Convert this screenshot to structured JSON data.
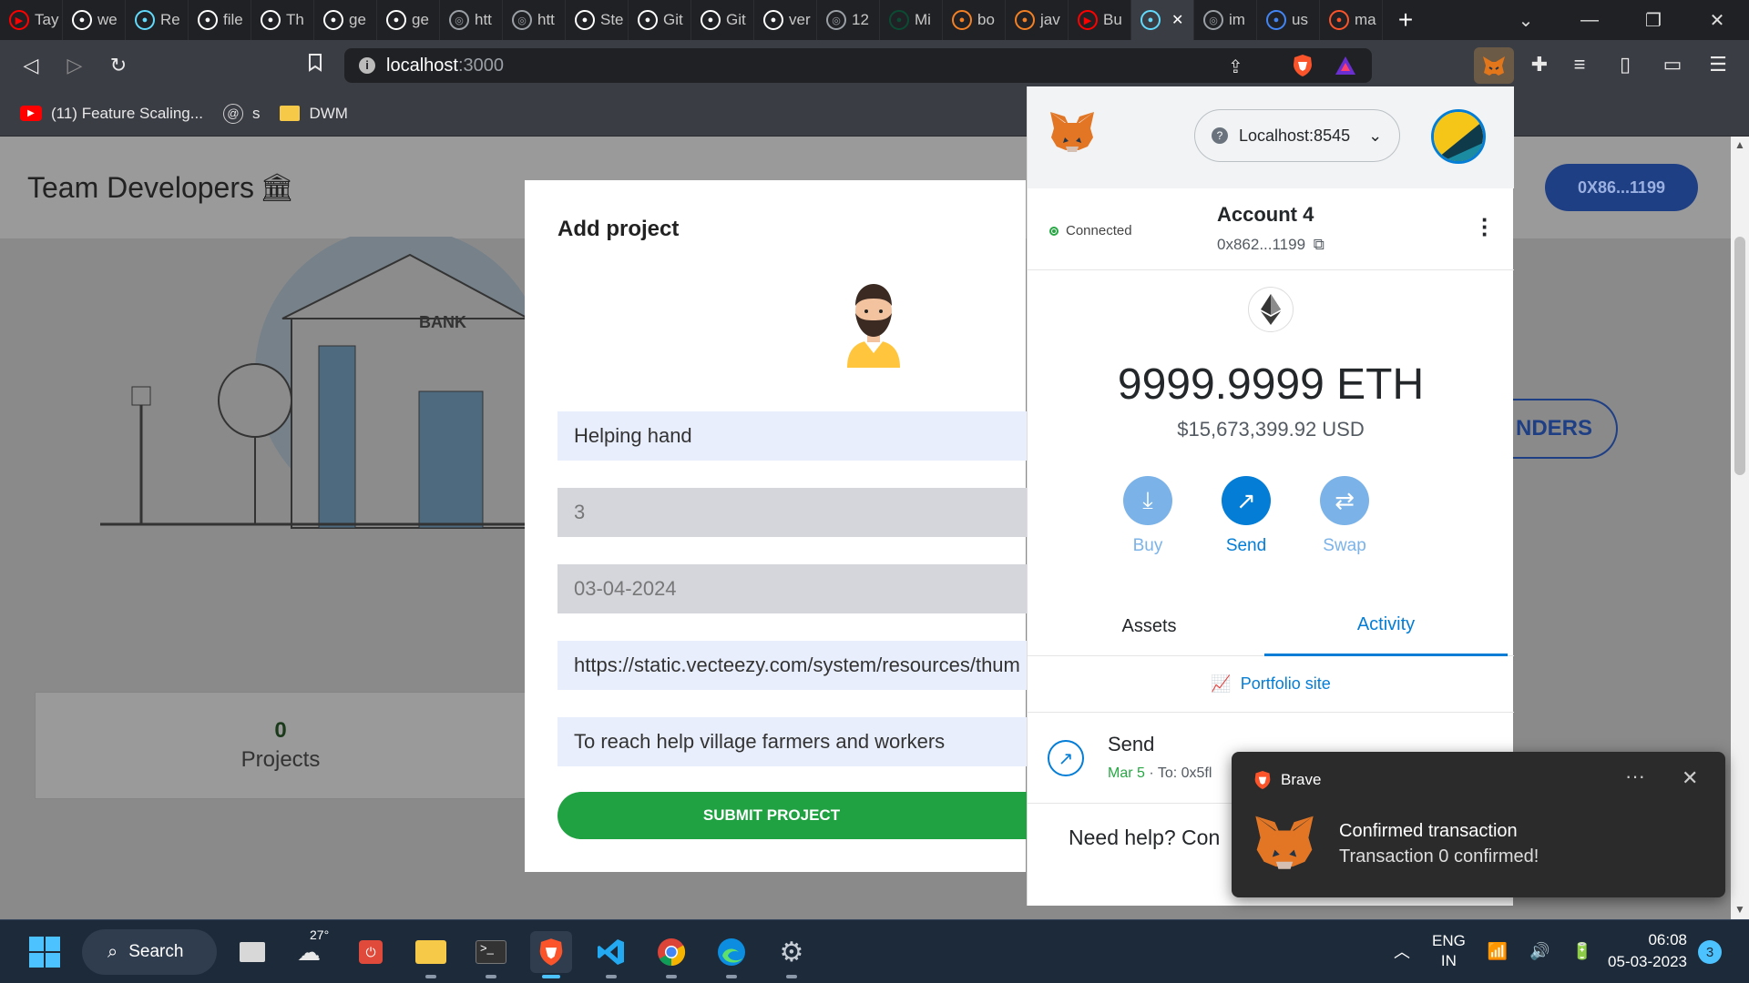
{
  "browser": {
    "tabs": [
      {
        "label": "Tay",
        "icon": "youtube-icon",
        "color": "#ff0000"
      },
      {
        "label": "we",
        "icon": "github-icon",
        "color": "#ffffff"
      },
      {
        "label": "Re",
        "icon": "react-icon",
        "color": "#61dafb"
      },
      {
        "label": "file",
        "icon": "github-icon",
        "color": "#ffffff"
      },
      {
        "label": "Th",
        "icon": "lambda-icon",
        "color": "#ffffff"
      },
      {
        "label": "ge",
        "icon": "github-icon",
        "color": "#ffffff"
      },
      {
        "label": "ge",
        "icon": "github-icon",
        "color": "#ffffff"
      },
      {
        "label": "htt",
        "icon": "globe-icon",
        "color": "#9aa0a6"
      },
      {
        "label": "htt",
        "icon": "globe-icon",
        "color": "#9aa0a6"
      },
      {
        "label": "Ste",
        "icon": "medium-icon",
        "color": "#ffffff"
      },
      {
        "label": "Git",
        "icon": "github-icon",
        "color": "#ffffff"
      },
      {
        "label": "Git",
        "icon": "github-icon",
        "color": "#ffffff"
      },
      {
        "label": "ver",
        "icon": "github-icon",
        "color": "#ffffff"
      },
      {
        "label": "12",
        "icon": "globe-icon",
        "color": "#9aa0a6"
      },
      {
        "label": "Mi",
        "icon": "django-icon",
        "color": "#0c4b33"
      },
      {
        "label": "bo",
        "icon": "stackoverflow-icon",
        "color": "#f48024"
      },
      {
        "label": "jav",
        "icon": "stackoverflow-icon",
        "color": "#f48024"
      },
      {
        "label": "Bu",
        "icon": "youtube-icon",
        "color": "#ff0000"
      },
      {
        "label": "",
        "icon": "react-icon",
        "color": "#61dafb"
      },
      {
        "label": "im",
        "icon": "globe-icon",
        "color": "#9aa0a6"
      },
      {
        "label": "us",
        "icon": "google-icon",
        "color": "#4285f4"
      },
      {
        "label": "ma",
        "icon": "brave-icon",
        "color": "#fb542b"
      }
    ],
    "url_host": "localhost",
    "url_path": ":3000",
    "bookmarks": [
      {
        "label": "(11) Feature Scaling...",
        "icon": "youtube-icon"
      },
      {
        "label": "s",
        "icon": "at-sign-icon"
      },
      {
        "label": "DWM",
        "icon": "folder-icon"
      }
    ]
  },
  "page": {
    "title": "Team Developers",
    "account_pill": "0X86...1199",
    "funders_partial": "NDERS",
    "stat": {
      "value": "0",
      "label": "Projects"
    }
  },
  "modal": {
    "title": "Add project",
    "fields": {
      "name": "Helping hand",
      "amount": "3",
      "date": "03-04-2024",
      "image_url": "https://static.vecteezy.com/system/resources/thum",
      "description": "To reach help village farmers and workers"
    },
    "submit_label": "SUBMIT PROJECT"
  },
  "metamask": {
    "network": "Localhost:8545",
    "status": "Connected",
    "account_name": "Account 4",
    "account_address": "0x862...1199",
    "balance": "9999.9999 ETH",
    "balance_usd": "$15,673,399.92 USD",
    "actions": {
      "buy": "Buy",
      "send": "Send",
      "swap": "Swap"
    },
    "tabs": {
      "assets": "Assets",
      "activity": "Activity"
    },
    "portfolio_link": "Portfolio site",
    "tx": {
      "title": "Send",
      "date": "Mar 5",
      "to": "To: 0x5fl"
    },
    "help_text": "Need help? Con",
    "accent": "#037dd6"
  },
  "toast": {
    "app": "Brave",
    "title": "Confirmed transaction",
    "body": "Transaction 0 confirmed!"
  },
  "taskbar": {
    "search": "Search",
    "weather": "27°",
    "lang_line1": "ENG",
    "lang_line2": "IN",
    "time": "06:08",
    "date": "05-03-2023",
    "notifications": "3"
  }
}
